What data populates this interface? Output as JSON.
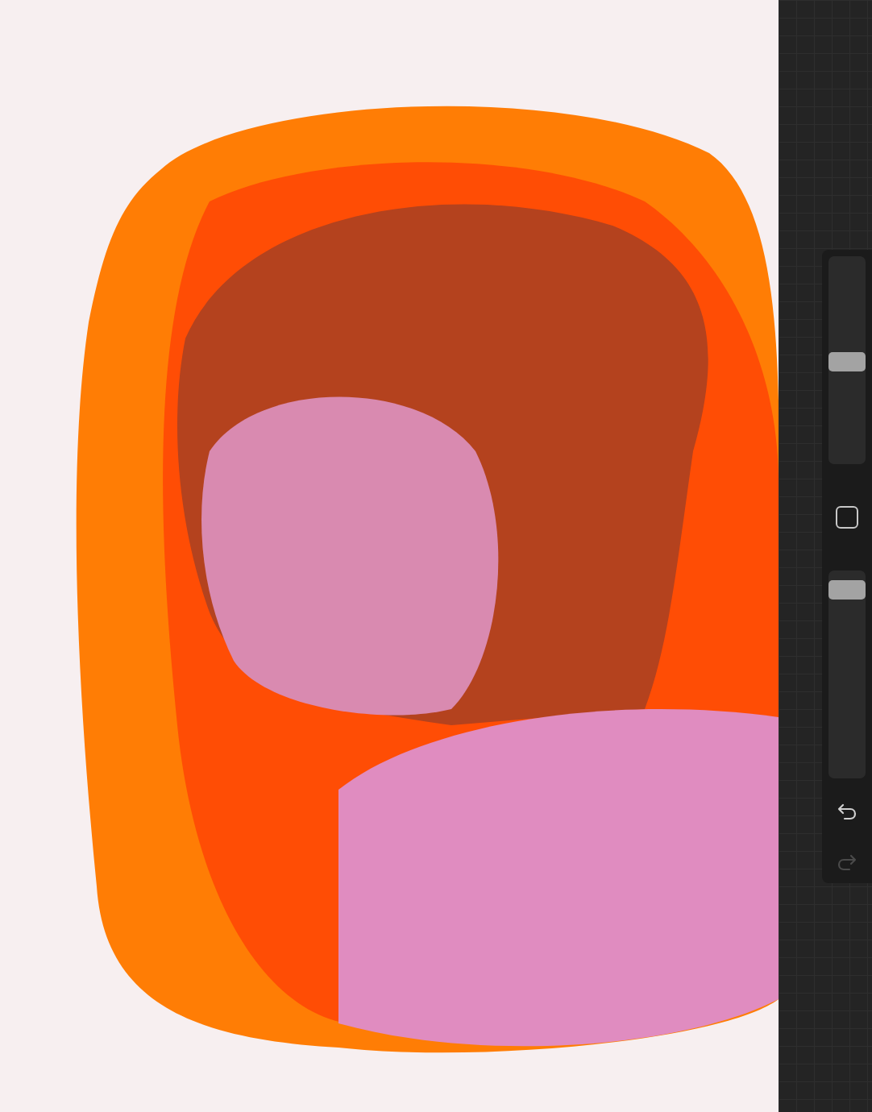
{
  "sidebar": {
    "sliders": [
      {
        "level": 0.49
      },
      {
        "level": 0.95
      }
    ],
    "undo": {
      "disabled": false
    },
    "redo": {
      "disabled": true
    }
  }
}
